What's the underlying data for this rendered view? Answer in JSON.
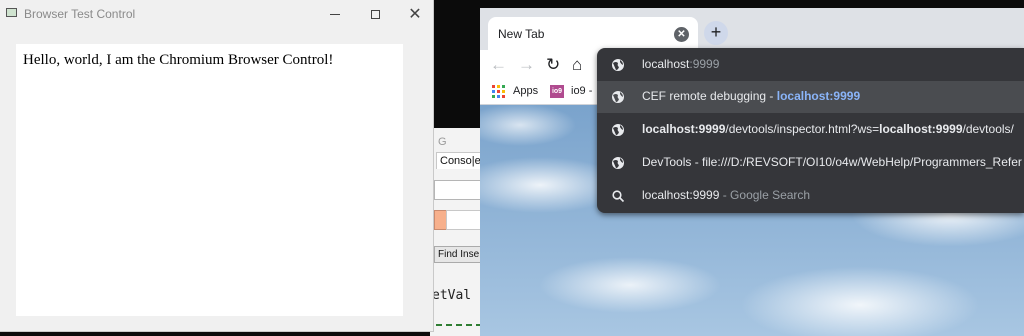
{
  "test_window": {
    "title": "Browser Test Control",
    "close_glyph": "✕",
    "body_text": "Hello, world, I am the Chromium Browser Control!"
  },
  "background_window": {
    "title_fragment": "G",
    "tab_label": "Conso|e",
    "button_label": "Find Inse",
    "code_text": "etVal"
  },
  "chrome": {
    "tab_title": "New Tab",
    "tab_close_glyph": "✕",
    "new_tab_glyph": "+",
    "back_glyph": "←",
    "forward_glyph": "→",
    "reload_glyph": "↻",
    "home_glyph": "⌂",
    "bookmarks": [
      {
        "label": "Apps",
        "icon": "apps-grid-icon"
      },
      {
        "label": "io9 -",
        "icon": "io9-icon",
        "icon_text": "io9"
      }
    ],
    "apps_colors": [
      "#ea4335",
      "#fbbc05",
      "#34a853",
      "#4285f4",
      "#ea4335",
      "#fbbc05",
      "#34a853",
      "#4285f4",
      "#ea4335"
    ]
  },
  "omnibox": {
    "suggestions": [
      {
        "icon": "globe-icon",
        "match": "localhost",
        "rest": ":9999"
      },
      {
        "icon": "globe-icon",
        "prefix": "CEF remote debugging",
        "sep": " - ",
        "link": "localhost:9999"
      },
      {
        "icon": "globe-icon",
        "b1": "localhost:9999",
        "t1": "/devtools/inspector.html?ws=",
        "b2": "localhost:9999",
        "t2": "/devtools/"
      },
      {
        "icon": "globe-icon",
        "text": "DevTools - file:///D:/REVSOFT/OI10/o4w/WebHelp/Programmers_Refer"
      },
      {
        "icon": "search-icon",
        "main": "localhost:9999",
        "sub": " - Google Search"
      }
    ]
  },
  "colors": {
    "omnibox_bg": "#35363a",
    "highlight_row": "#4a4c50",
    "link_blue": "#8ab4f8"
  }
}
